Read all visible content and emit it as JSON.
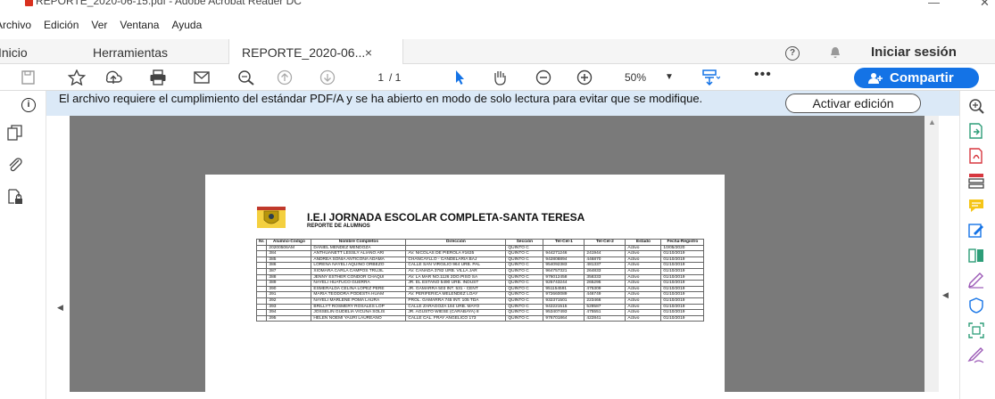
{
  "window": {
    "title": "REPORTE_2020-06-15.pdf - Adobe Acrobat Reader DC",
    "minimize": "—",
    "close": "✕"
  },
  "menu": [
    "Archivo",
    "Edición",
    "Ver",
    "Ventana",
    "Ayuda"
  ],
  "tabs": {
    "home": "Inicio",
    "tools": "Herramientas",
    "document": "REPORTE_2020-06...",
    "close": "×"
  },
  "header": {
    "help": "?",
    "signin": "Iniciar sesión"
  },
  "toolbar": {
    "page_current": "1",
    "page_total": "/ 1",
    "zoom": "50%",
    "more": "•••",
    "share": "Compartir",
    "icons": [
      "save-icon",
      "bookmark-star-icon",
      "upload-icon",
      "print-icon",
      "email-icon",
      "zoom-search-icon",
      "page-up-icon",
      "page-down-icon",
      "select-pointer-icon",
      "hand-tool-icon",
      "zoom-out-icon",
      "zoom-in-icon",
      "fit-page-icon"
    ]
  },
  "notice": {
    "message": "El archivo requiere el cumplimiento del estándar PDF/A y se ha abierto en modo de solo lectura para evitar que se modifique.",
    "activate": "Activar edición"
  },
  "document": {
    "school": "I.E.I JORNADA ESCOLAR COMPLETA-SANTA TERESA",
    "report": "REPORTE DE ALUMNOS",
    "columns": [
      "Nr.",
      "Alumno-Código",
      "Nombre Completos",
      "Dirección",
      "Sección",
      "Tel-Cel-1",
      "Tel-Cel-2",
      "Estado",
      "Fecha-Registro"
    ],
    "rows": [
      [
        "",
        "20200506AM",
        "DANIEL MENDEZ MENDOZA",
        "",
        "QUINTO C",
        "",
        "",
        "Activo",
        "10/05/2020"
      ],
      [
        "",
        "384",
        "ANTHUANETT LESSLY ALIANO ARI",
        "AV. NICOLAS DE PIEROLA #1635",
        "QUINTO C",
        "944271246",
        "241944",
        "Activo",
        "01/10/2019"
      ],
      [
        "",
        "385",
        "ANDREA SONIA ANTICONA ADAMA",
        "CHANCAYLLO - CANDELARIA BAJ",
        "QUINTO C",
        "942808894",
        "446870",
        "Activo",
        "01/10/2019"
      ],
      [
        "",
        "386",
        "LORENA NAYELI AQUINO ORBEZO",
        "CALLE SAN VIRGILIO 964 URB. PAL",
        "QUINTO C",
        "954092383",
        "481337",
        "Activo",
        "01/10/2019"
      ],
      [
        "",
        "387",
        "XIOMARA CARLA CAMPOS TRUJIL",
        "AV. CANADA 3782 URB. VILLA JAR",
        "QUINTO C",
        "964757321",
        "264833",
        "Activo",
        "01/10/2019"
      ],
      [
        "",
        "388",
        "JENNY ESTHER CONDOR CHAQUI",
        "AV. LA MAR NO.1126 2DO.PISO SA",
        "QUINTO C",
        "976012458",
        "358333",
        "Activo",
        "01/10/2019"
      ],
      [
        "",
        "389",
        "NAYELI HUATUCO GUERRA",
        "JR. EL ESTAÑO 5490 URB. INDUST",
        "QUINTO C",
        "925743244",
        "265295",
        "Activo",
        "01/10/2019"
      ],
      [
        "",
        "390",
        "ESMERALDA CELINA LOPEZ PERE",
        "JR. GAMARRA 503 INT. 531 - CENT",
        "QUINTO C",
        "951154591",
        "475309",
        "Activo",
        "01/10/2019"
      ],
      [
        "",
        "391",
        "MARIA TEODORA PODESTA HUAM",
        "AV. PERIFERICA MELENDEZ LOAY",
        "QUINTO C",
        "972660089",
        "446749",
        "Activo",
        "01/10/2019"
      ],
      [
        "",
        "392",
        "NAYELI MARLENE POMA LAURA",
        "PROL. GAMARRA 745 INT. 105 TDA",
        "QUINTO C",
        "932371501",
        "223466",
        "Activo",
        "01/10/2019"
      ],
      [
        "",
        "393",
        "BRILLYT ROSMERY ROSALES LOP",
        "CALLE ZARAGOZA 184 URB. MAYO",
        "QUINTO C",
        "942221515",
        "528587",
        "Activo",
        "01/10/2019"
      ],
      [
        "",
        "394",
        "JOSSELIN GUDELIA VICUÑA SOLIS",
        "JR. AGUSTO WIESE (CARABAYA) 8",
        "QUINTO C",
        "953407493",
        "475551",
        "Activo",
        "01/10/2019"
      ],
      [
        "",
        "395",
        "HELEN NOEMI YAURI LAUREANO",
        "CALLE CAL. FRAY ANGELICO 173",
        "QUINTO C",
        "976701864",
        "422841",
        "Activo",
        "01/10/2019"
      ]
    ]
  },
  "colors": {
    "accent": "#1473e6",
    "notice_bg": "#dbe9f7",
    "doc_bg": "#7a7a7a"
  },
  "right_tools": [
    "zoom-tool-icon",
    "export-pdf-icon",
    "create-pdf-icon",
    "organize-pages-icon",
    "comment-icon",
    "edit-pdf-icon",
    "compare-icon",
    "fill-sign-icon",
    "protect-icon",
    "scan-icon",
    "sign-icon"
  ]
}
